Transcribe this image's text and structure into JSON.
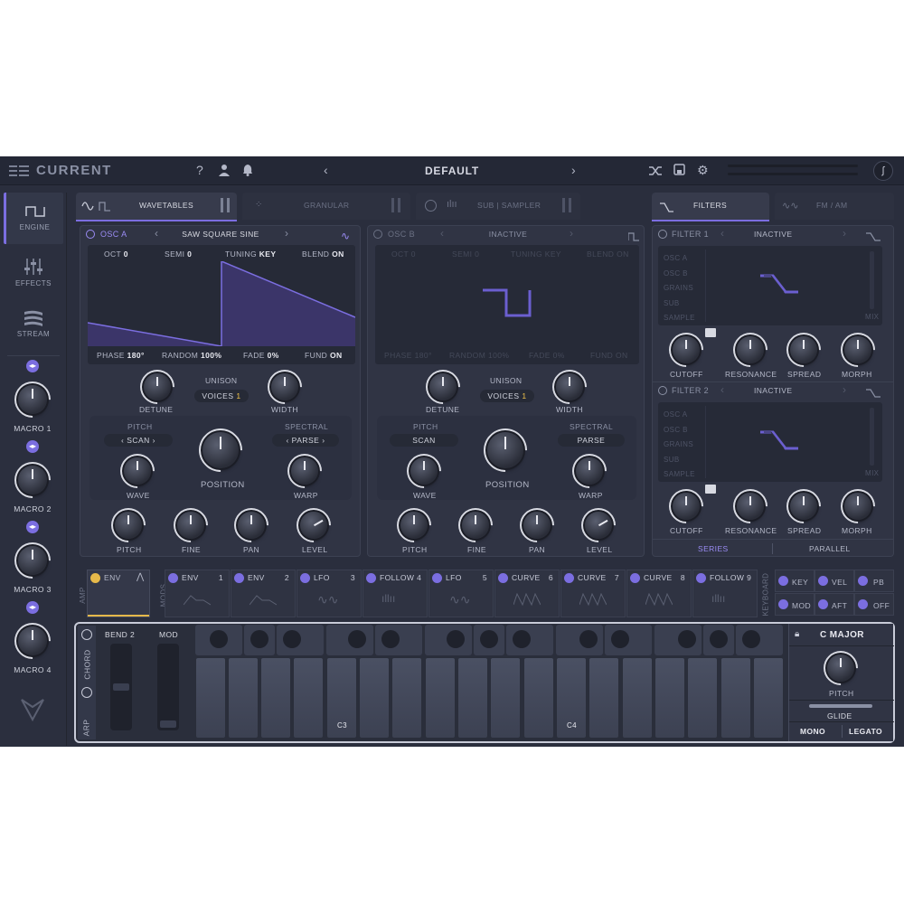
{
  "app": {
    "name": "CURRENT",
    "preset": "DEFAULT"
  },
  "sidebar": {
    "items": [
      {
        "label": "ENGINE",
        "icon": "wave-square-icon"
      },
      {
        "label": "EFFECTS",
        "icon": "sliders-icon"
      },
      {
        "label": "STREAM",
        "icon": "flag-icon"
      }
    ],
    "macros": [
      "MACRO 1",
      "MACRO 2",
      "MACRO 3",
      "MACRO 4"
    ]
  },
  "tabs": {
    "left": [
      "WAVETABLES",
      "GRANULAR",
      "SUB | SAMPLER"
    ],
    "right": [
      "FILTERS",
      "FM / AM"
    ]
  },
  "osc_a": {
    "title": "OSC A",
    "wavetable": "SAW SQUARE SINE",
    "oct_label": "OCT",
    "oct": "0",
    "semi_label": "SEMI",
    "semi": "0",
    "tuning_label": "TUNING",
    "tuning": "KEY",
    "blend_label": "BLEND",
    "blend": "ON",
    "phase_label": "PHASE",
    "phase": "180°",
    "random_label": "RANDOM",
    "random": "100%",
    "fade_label": "FADE",
    "fade": "0%",
    "fund_label": "FUND",
    "fund": "ON",
    "unison": "UNISON",
    "voices_label": "VOICES",
    "voices": "1",
    "detune": "DETUNE",
    "width": "WIDTH",
    "pitch_mode": "PITCH",
    "pitch_sel": "SCAN",
    "spectral": "SPECTRAL",
    "spectral_sel": "PARSE",
    "wave": "WAVE",
    "position": "POSITION",
    "warp": "WARP",
    "pitch": "PITCH",
    "fine": "FINE",
    "pan": "PAN",
    "level": "LEVEL"
  },
  "osc_b": {
    "title": "OSC B",
    "state": "INACTIVE",
    "oct_label": "OCT",
    "oct": "0",
    "semi_label": "SEMI",
    "semi": "0",
    "tuning_label": "TUNING",
    "tuning": "KEY",
    "blend_label": "BLEND",
    "blend": "ON",
    "phase_label": "PHASE",
    "phase": "180°",
    "random_label": "RANDOM",
    "random": "100%",
    "fade_label": "FADE",
    "fade": "0%",
    "fund_label": "FUND",
    "fund": "ON",
    "unison": "UNISON",
    "voices_label": "VOICES",
    "voices": "1",
    "detune": "DETUNE",
    "width": "WIDTH",
    "pitch_mode": "PITCH",
    "pitch_sel": "SCAN",
    "spectral": "SPECTRAL",
    "spectral_sel": "PARSE",
    "wave": "WAVE",
    "position": "POSITION",
    "warp": "WARP",
    "pitch": "PITCH",
    "fine": "FINE",
    "pan": "PAN",
    "level": "LEVEL"
  },
  "filters": {
    "f1": {
      "title": "FILTER 1",
      "state": "INACTIVE"
    },
    "f2": {
      "title": "FILTER 2",
      "state": "INACTIVE"
    },
    "sources": [
      "OSC A",
      "OSC B",
      "GRAINS",
      "SUB",
      "SAMPLE"
    ],
    "mix": "MIX",
    "knobs": [
      "CUTOFF",
      "RESONANCE",
      "SPREAD",
      "MORPH"
    ],
    "routing": [
      "SERIES",
      "PARALLEL"
    ]
  },
  "mods": {
    "amp_label": "AMP",
    "mods_label": "MODS",
    "amp_env": "ENV",
    "cells": [
      {
        "name": "ENV",
        "num": "1"
      },
      {
        "name": "ENV",
        "num": "2"
      },
      {
        "name": "LFO",
        "num": "3"
      },
      {
        "name": "FOLLOW",
        "num": "4"
      },
      {
        "name": "LFO",
        "num": "5"
      },
      {
        "name": "CURVE",
        "num": "6"
      },
      {
        "name": "CURVE",
        "num": "7"
      },
      {
        "name": "CURVE",
        "num": "8"
      },
      {
        "name": "FOLLOW",
        "num": "9"
      }
    ],
    "keyboard_label": "KEYBOARD",
    "kb_buttons": [
      "KEY",
      "VEL",
      "PB",
      "MOD",
      "AFT",
      "OFF"
    ]
  },
  "keys": {
    "chord": "CHORD",
    "arp": "ARP",
    "bend_label": "BEND",
    "bend": "2",
    "mod": "MOD",
    "c3": "C3",
    "c4": "C4",
    "scale": "C MAJOR",
    "pitch": "PITCH",
    "glide": "GLIDE",
    "mono": "MONO",
    "legato": "LEGATO"
  }
}
